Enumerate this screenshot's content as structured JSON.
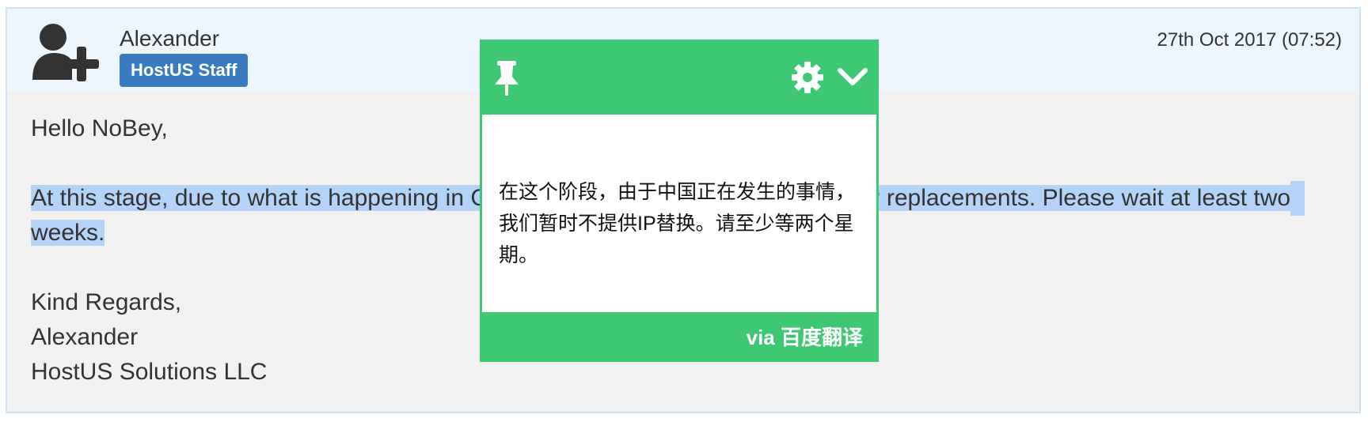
{
  "post": {
    "author": "Alexander",
    "badge": "HostUS Staff",
    "date": "27th Oct 2017 (07:52)",
    "avatar_icon": "add-user-icon"
  },
  "message": {
    "greeting": "Hello NoBey,",
    "body_part1": "At this stage, due to what is happening in C",
    "body_part2": "P replacements. Please wait at least two",
    "body_part3": "weeks.",
    "signoff": "Kind Regards,",
    "signer": "Alexander",
    "company": "HostUS Solutions LLC"
  },
  "translate_popup": {
    "translation": "在这个阶段，由于中国正在发生的事情，我们暂时不提供IP替换。请至少等两个星期。",
    "footer": "via 百度翻译",
    "icons": [
      "pin-icon",
      "gear-icon",
      "chevron-down-icon"
    ],
    "accent_color": "#3ec874"
  },
  "colors": {
    "header_bg": "#eef6fd",
    "badge_bg": "#3a7bbf",
    "highlight": "#b4d3f7",
    "body_bg": "#f1f1f1"
  }
}
